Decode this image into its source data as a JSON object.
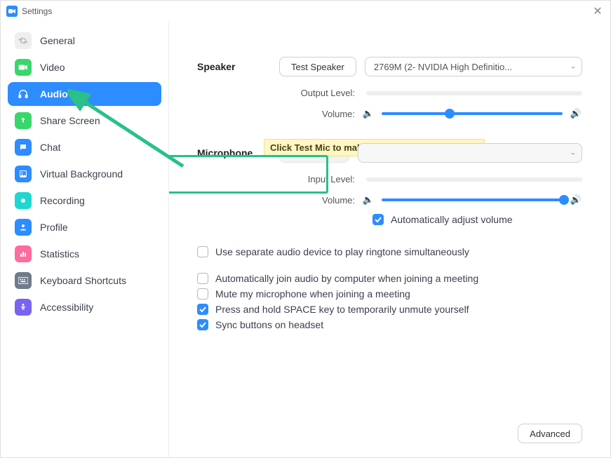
{
  "window": {
    "title": "Settings"
  },
  "sidebar": {
    "items": [
      {
        "label": "General"
      },
      {
        "label": "Video"
      },
      {
        "label": "Audio"
      },
      {
        "label": "Share Screen"
      },
      {
        "label": "Chat"
      },
      {
        "label": "Virtual Background"
      },
      {
        "label": "Recording"
      },
      {
        "label": "Profile"
      },
      {
        "label": "Statistics"
      },
      {
        "label": "Keyboard Shortcuts"
      },
      {
        "label": "Accessibility"
      }
    ]
  },
  "audio": {
    "speaker_label": "Speaker",
    "test_speaker_btn": "Test Speaker",
    "speaker_device": "2769M (2- NVIDIA High Definitio...",
    "output_level_label": "Output Level:",
    "volume_label": "Volume:",
    "callout_text": "Click Test Mic to make sure others can hear you",
    "microphone_label": "Microphone",
    "test_mic_btn": "Test Mic",
    "mic_device": "",
    "input_level_label": "Input Level:",
    "auto_adjust_label": "Automatically adjust volume",
    "options": [
      {
        "label": "Use separate audio device to play ringtone simultaneously",
        "checked": false
      },
      {
        "label": "Automatically join audio by computer when joining a meeting",
        "checked": false
      },
      {
        "label": "Mute my microphone when joining a meeting",
        "checked": false
      },
      {
        "label": "Press and hold SPACE key to temporarily unmute yourself",
        "checked": true
      },
      {
        "label": "Sync buttons on headset",
        "checked": true
      }
    ],
    "advanced_btn": "Advanced"
  },
  "slider": {
    "speaker_pct": 35,
    "mic_pct": 98
  }
}
